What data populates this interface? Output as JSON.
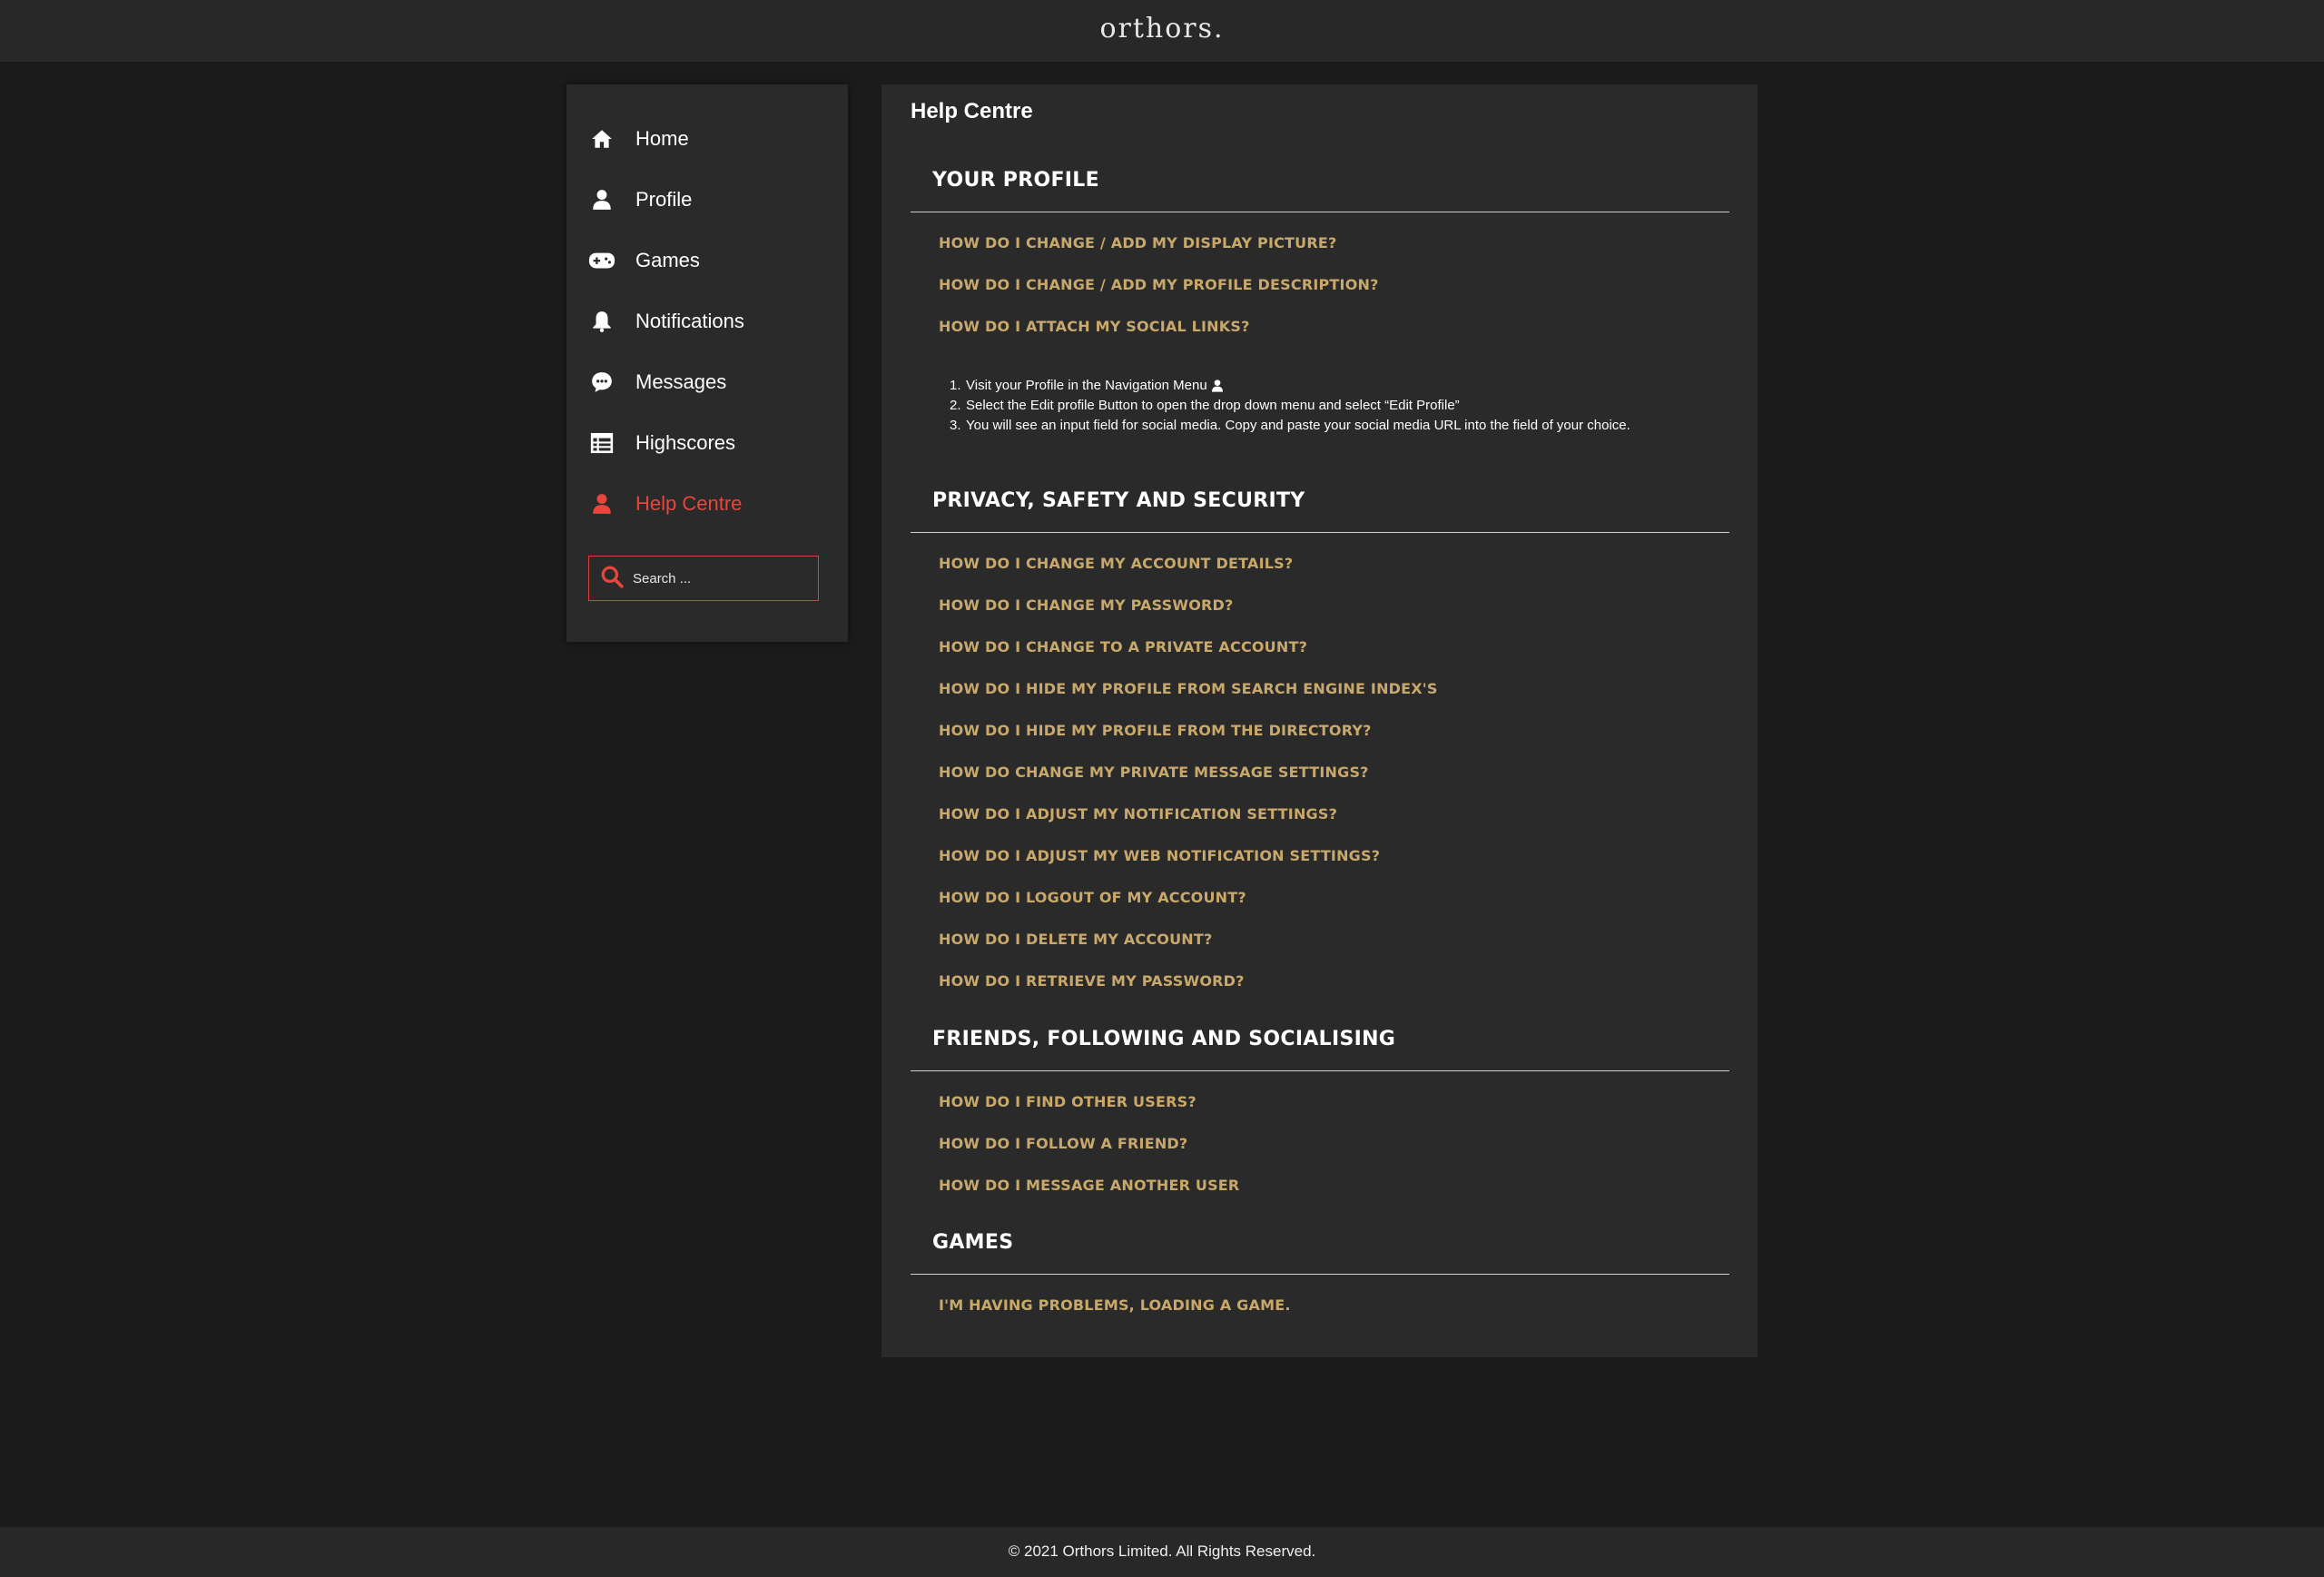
{
  "header": {
    "logo": "orthors."
  },
  "sidebar": {
    "items": [
      {
        "label": "Home",
        "icon": "home-icon"
      },
      {
        "label": "Profile",
        "icon": "user-icon"
      },
      {
        "label": "Games",
        "icon": "gamepad-icon"
      },
      {
        "label": "Notifications",
        "icon": "bell-icon"
      },
      {
        "label": "Messages",
        "icon": "chat-icon"
      },
      {
        "label": "Highscores",
        "icon": "table-icon"
      },
      {
        "label": "Help Centre",
        "icon": "user-icon",
        "active": true
      }
    ],
    "search": {
      "placeholder": "Search ..."
    }
  },
  "main": {
    "title": "Help Centre",
    "sections": [
      {
        "title": "YOUR PROFILE",
        "links": [
          "HOW DO I CHANGE / ADD MY DISPLAY PICTURE?",
          "HOW DO I CHANGE / ADD MY PROFILE DESCRIPTION?",
          "HOW DO I ATTACH MY SOCIAL LINKS?"
        ],
        "steps": [
          "Visit your Profile in the Navigation Menu",
          "Select the Edit profile Button to open the drop down menu and select “Edit Profile”",
          "You will see an input field for social media. Copy and paste your social media URL into the field of your choice."
        ]
      },
      {
        "title": "PRIVACY, SAFETY AND SECURITY",
        "links": [
          "HOW DO I CHANGE MY ACCOUNT DETAILS?",
          "HOW DO I CHANGE MY PASSWORD?",
          "HOW DO I CHANGE TO A PRIVATE ACCOUNT?",
          "HOW DO I HIDE MY PROFILE FROM SEARCH ENGINE INDEX'S",
          "HOW DO I HIDE MY PROFILE FROM THE DIRECTORY?",
          "HOW DO CHANGE MY PRIVATE MESSAGE SETTINGS?",
          "HOW DO I ADJUST MY NOTIFICATION SETTINGS?",
          "HOW DO I ADJUST MY WEB NOTIFICATION SETTINGS?",
          "HOW DO I LOGOUT OF MY ACCOUNT?",
          "HOW DO I DELETE MY ACCOUNT?",
          "HOW DO I RETRIEVE MY PASSWORD?"
        ]
      },
      {
        "title": "FRIENDS, FOLLOWING AND SOCIALISING",
        "links": [
          "HOW DO I FIND OTHER USERS?",
          "HOW DO I FOLLOW A FRIEND?",
          "HOW DO I MESSAGE ANOTHER USER"
        ]
      },
      {
        "title": "GAMES",
        "links": [
          "I'M HAVING PROBLEMS, LOADING A GAME."
        ]
      }
    ]
  },
  "footer": {
    "copyright": "© 2021 Orthors Limited. All Rights Reserved."
  },
  "colors": {
    "background": "#1b1b1b",
    "panel": "#2a2a2a",
    "accent": "#e8453c",
    "link": "#c9a86b"
  }
}
